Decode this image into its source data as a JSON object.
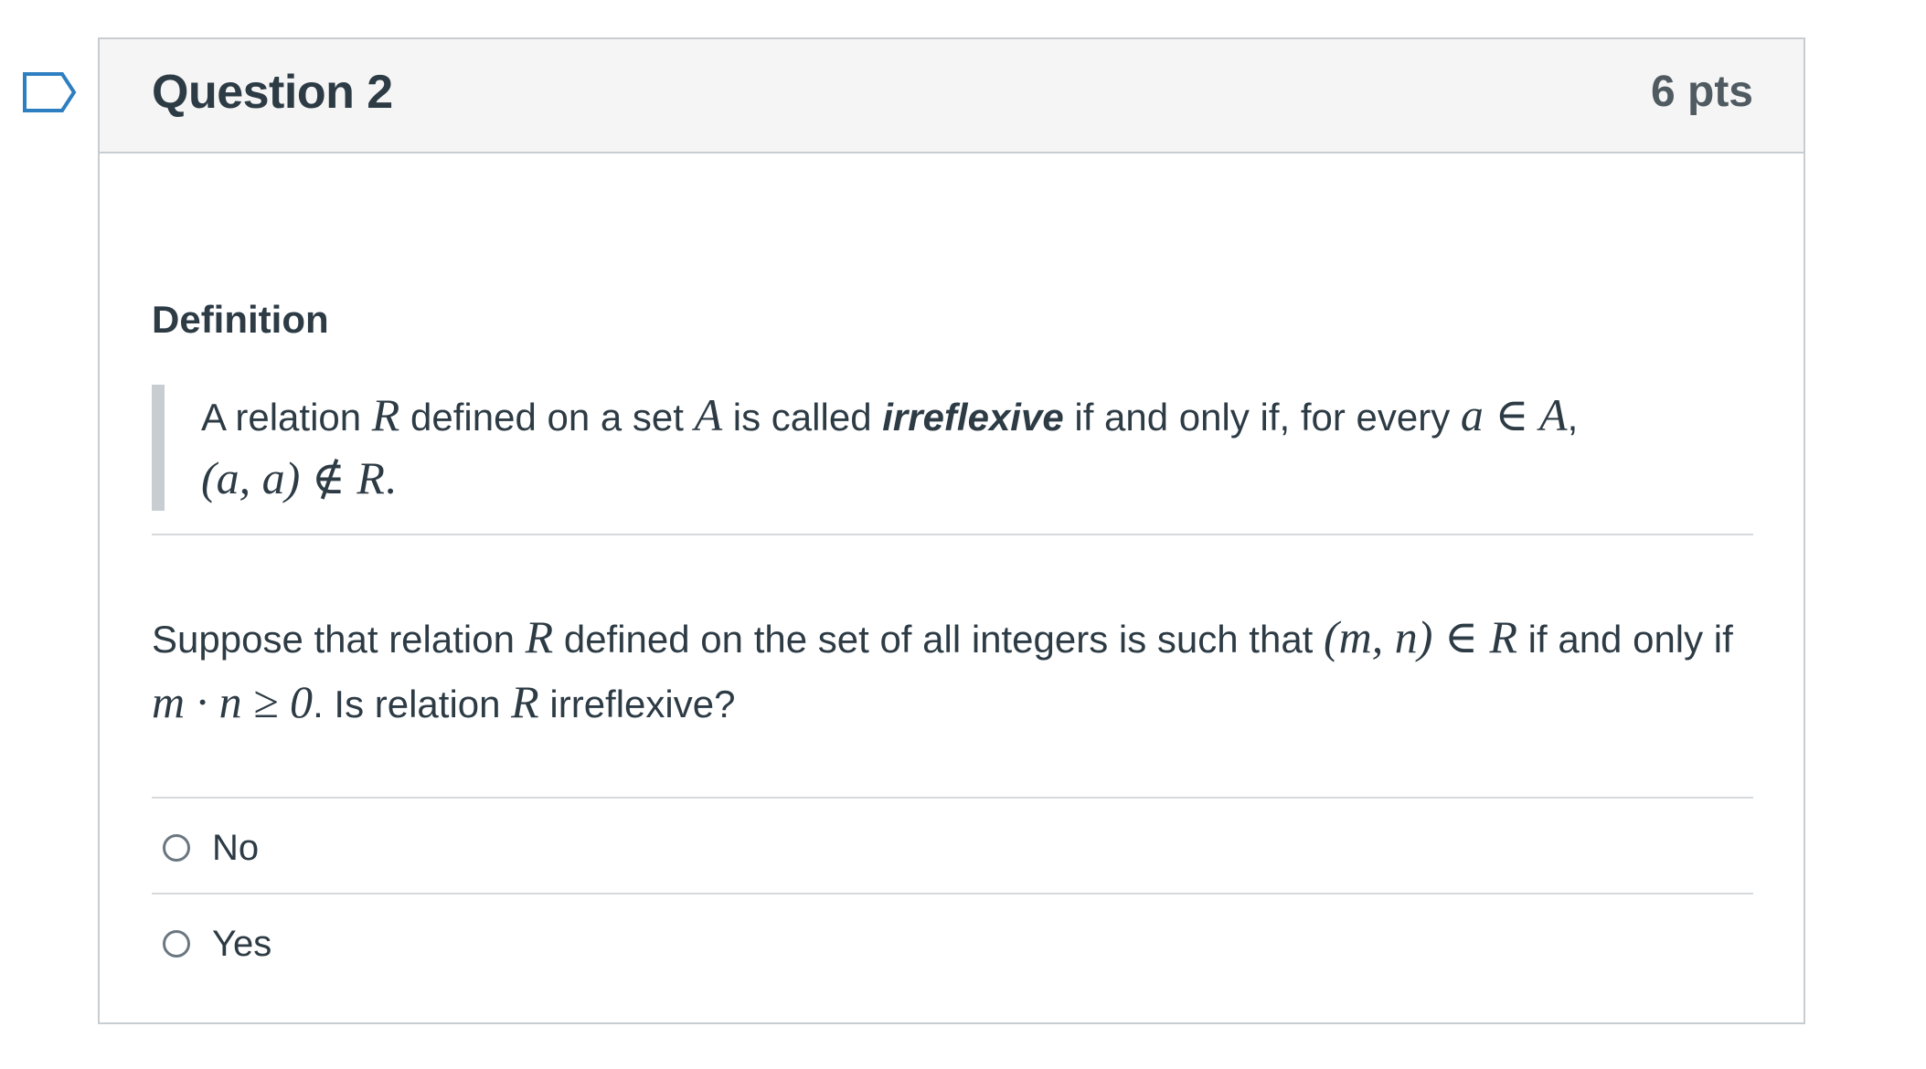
{
  "question": {
    "title": "Question 2",
    "points": "6 pts"
  },
  "definition": {
    "heading": "Definition",
    "text_1": "A relation ",
    "var_R": "R",
    "text_2": " defined on a set ",
    "var_A": "A",
    "text_3": " is called ",
    "term": "irreflexive",
    "text_4": " if and only if, for every ",
    "math_a_in_A": "a ∈ A",
    "text_5": ",",
    "math_pair_not_in": "(a, a) ∉ R",
    "text_6": "."
  },
  "prompt": {
    "text_1": "Suppose that relation ",
    "var_R": "R",
    "text_2": " defined on the set of all integers is such that ",
    "math_pair": "(m, n) ∈ R",
    "text_3": " if and only if ",
    "math_product": "m · n ≥ 0",
    "text_4": ".  Is relation ",
    "var_R2": "R",
    "text_5": " irreflexive?"
  },
  "answers": [
    {
      "label": "No"
    },
    {
      "label": "Yes"
    }
  ]
}
